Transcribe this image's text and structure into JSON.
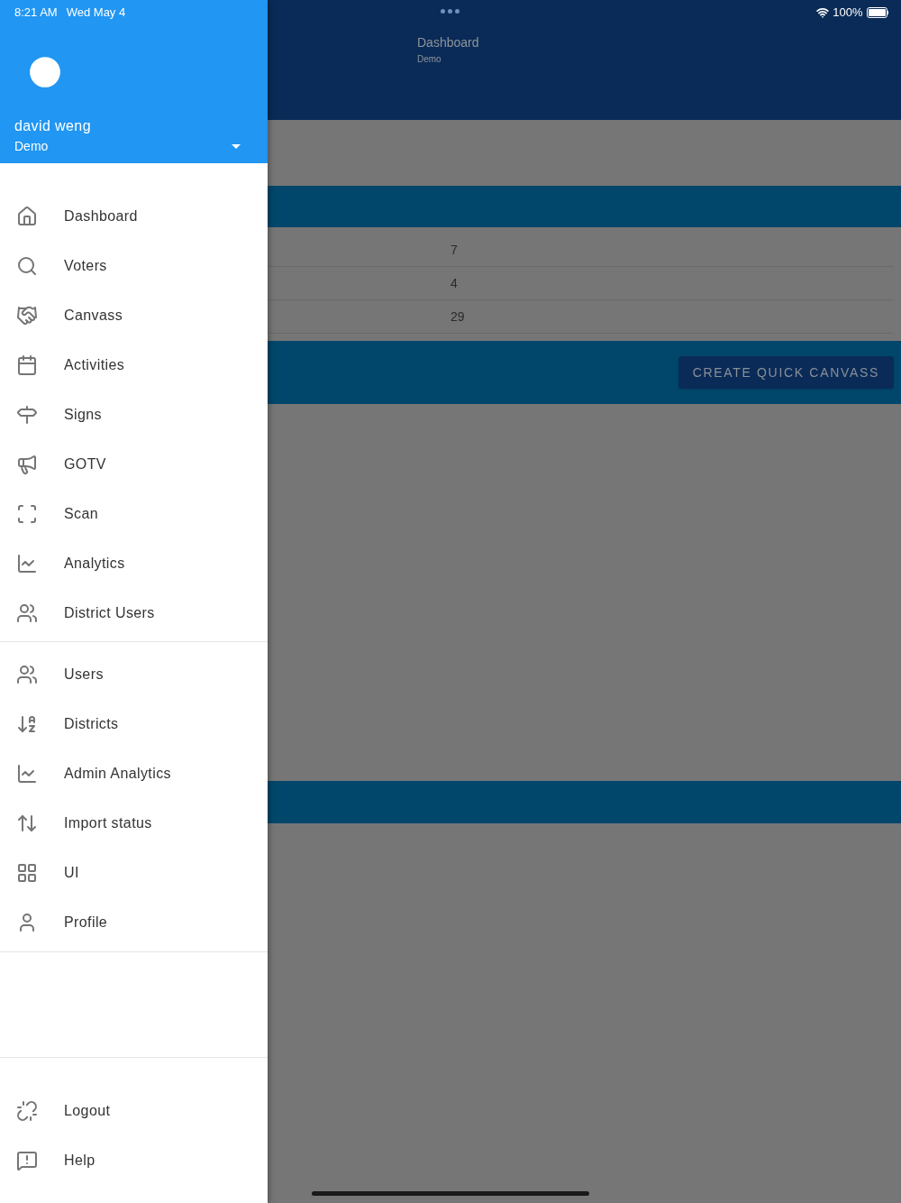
{
  "status_bar": {
    "time": "8:21 AM",
    "date": "Wed May 4",
    "battery": "100%"
  },
  "drawer": {
    "user_name": "david weng",
    "account": "Demo",
    "groups": [
      {
        "items": [
          {
            "label": "Dashboard"
          },
          {
            "label": "Voters"
          },
          {
            "label": "Canvass"
          },
          {
            "label": "Activities"
          },
          {
            "label": "Signs"
          },
          {
            "label": "GOTV"
          },
          {
            "label": "Scan"
          },
          {
            "label": "Analytics"
          },
          {
            "label": "District Users"
          }
        ]
      },
      {
        "items": [
          {
            "label": "Users"
          },
          {
            "label": "Districts"
          },
          {
            "label": "Admin Analytics"
          },
          {
            "label": "Import status"
          },
          {
            "label": "UI"
          },
          {
            "label": "Profile"
          }
        ]
      },
      {
        "items": [
          {
            "label": "Logout"
          },
          {
            "label": "Help"
          }
        ]
      }
    ]
  },
  "app_bar": {
    "title": "Dashboard",
    "subtitle": "Demo"
  },
  "table": {
    "rows": [
      {
        "value": "7"
      },
      {
        "value": "4"
      },
      {
        "value": "29"
      }
    ]
  },
  "button": {
    "label": "CREATE QUICK CANVASS"
  }
}
